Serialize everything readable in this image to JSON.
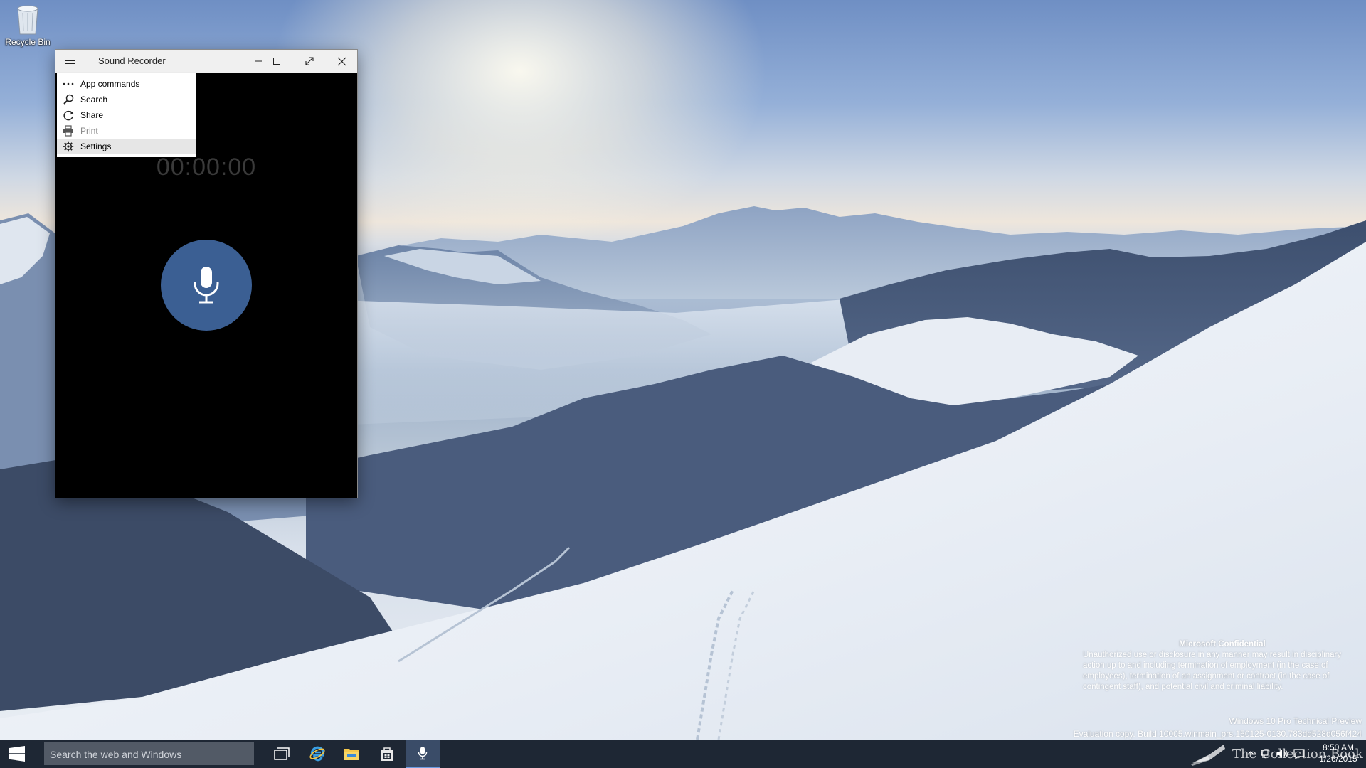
{
  "desktop": {
    "recycle_bin_label": "Recycle Bin"
  },
  "window": {
    "title": "Sound Recorder",
    "timer": "00:00:00",
    "accent_color": "#3b5f93"
  },
  "app_menu": {
    "items": [
      {
        "label": "App commands",
        "icon": "more-dots-icon",
        "enabled": true
      },
      {
        "label": "Search",
        "icon": "search-icon",
        "enabled": true
      },
      {
        "label": "Share",
        "icon": "share-icon",
        "enabled": true
      },
      {
        "label": "Print",
        "icon": "print-icon",
        "enabled": false
      },
      {
        "label": "Settings",
        "icon": "gear-icon",
        "enabled": true,
        "highlighted": true
      }
    ]
  },
  "watermark": {
    "title": "Microsoft Confidential",
    "body": "Unauthorized use or disclosure in any manner may result in disciplinary action up to and including termination of employment (in the case of employees), termination of an assignment or contract (in the case of contingent staff), and potential civil and criminal liability.",
    "edition": "Windows 10 Pro Technical Preview",
    "build": "Evaluation copy. Build 10005.winmain_prs.150125-0130.783dd528d056f424"
  },
  "taskbar": {
    "search_placeholder": "Search the web and Windows",
    "brand_text": "The Collection Book",
    "time": "8:50 AM",
    "date": "1/26/2015",
    "background_color": "#1e2734"
  }
}
